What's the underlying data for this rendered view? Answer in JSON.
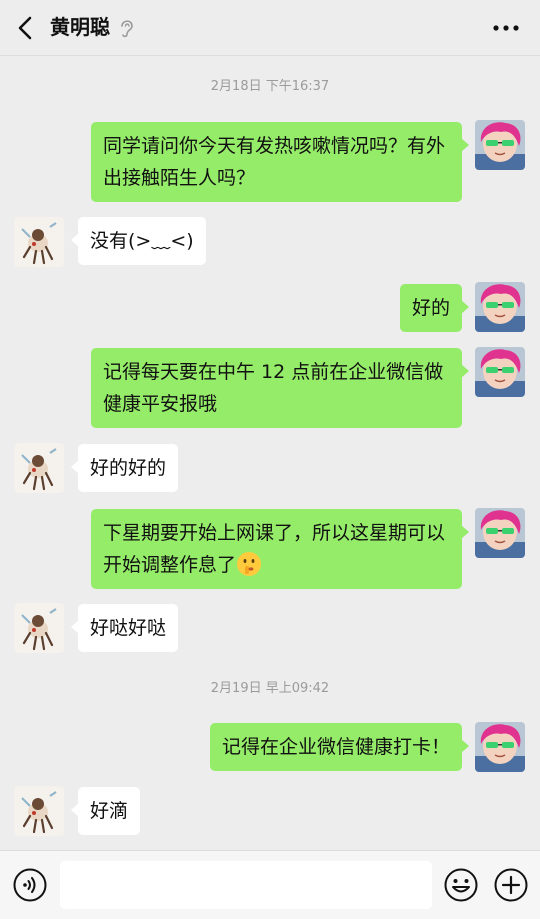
{
  "header": {
    "title": "黄明聪",
    "back_icon": "chevron-left-icon",
    "ear_icon": "ear-icon",
    "more_icon": "more-dots-icon"
  },
  "timestamps": [
    "2月18日 下午16:37",
    "2月19日 早上09:42"
  ],
  "messages": [
    {
      "sender": "self",
      "text": "同学请问你今天有发热咳嗽情况吗？有外出接触陌生人吗？"
    },
    {
      "sender": "other",
      "text": "没有(>﹏<)"
    },
    {
      "sender": "self",
      "text": "好的"
    },
    {
      "sender": "self",
      "text": "记得每天要在中午 12 点前在企业微信做健康平安报哦"
    },
    {
      "sender": "other",
      "text": "好的好的"
    },
    {
      "sender": "self",
      "text": "下星期要开始上网课了，所以这星期可以开始调整作息了",
      "emoji": "shushing-face-emoji"
    },
    {
      "sender": "other",
      "text": "好哒好哒"
    },
    {
      "sender": "self",
      "text": "记得在企业微信健康打卡！"
    },
    {
      "sender": "other",
      "text": "好滴"
    }
  ],
  "input_bar": {
    "voice_icon": "voice-icon",
    "emoji_icon": "emoji-icon",
    "plus_icon": "plus-icon",
    "input_value": ""
  },
  "colors": {
    "background": "#ededed",
    "self_bubble": "#95ec69",
    "other_bubble": "#ffffff",
    "avatar_self_hair": "#e0338f"
  }
}
